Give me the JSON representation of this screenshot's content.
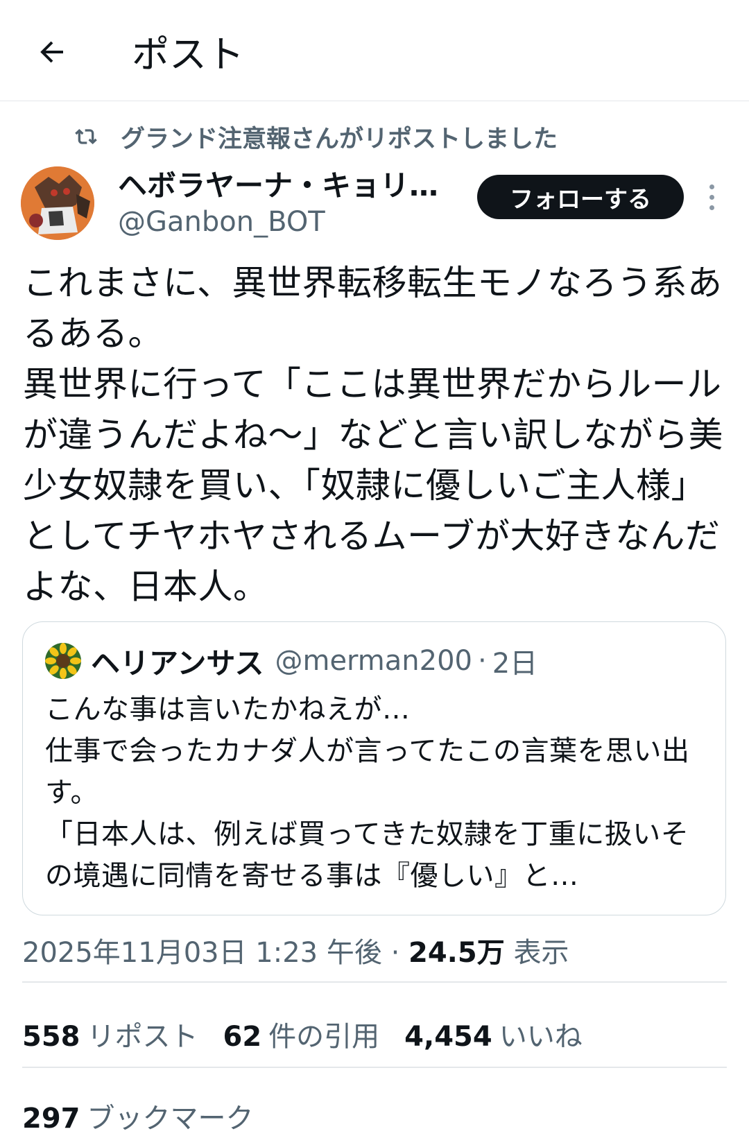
{
  "header": {
    "title": "ポスト"
  },
  "repost": {
    "text": "グランド注意報さんがリポストしました"
  },
  "author": {
    "name": "ヘボラヤーナ・キョリ…",
    "handle": "@Ganbon_BOT",
    "follow_label": "フォローする"
  },
  "post": {
    "body": "これまさに、異世界転移転生モノなろう系あるある。\n異世界に行って「ここは異世界だからルールが違うんだよね〜」などと言い訳しながら美少女奴隷を買い、「奴隷に優しいご主人様」としてチヤホヤされるムーブが大好きなんだよな、日本人。"
  },
  "quote": {
    "name": "ヘリアンサス",
    "handle": "@merman200",
    "separator": "·",
    "time": "2日",
    "body": "こんな事は言いたかねえが…\n仕事で会ったカナダ人が言ってたこの言葉を思い出す。\n「日本人は、例えば買ってきた奴隷を丁重に扱いその境遇に同情を寄せる事は『優しい』と…"
  },
  "meta": {
    "timestamp": "2025年11月03日 1:23 午後",
    "separator": "·",
    "views_count": "24.5万",
    "views_label": "表示"
  },
  "stats": {
    "reposts_count": "558",
    "reposts_label": "リポスト",
    "quotes_count": "62",
    "quotes_label": "件の引用",
    "likes_count": "4,454",
    "likes_label": "いいね",
    "bookmarks_count": "297",
    "bookmarks_label": "ブックマーク"
  },
  "icons": {
    "back": "arrow-left-icon",
    "repost": "repost-icon",
    "more": "more-vertical-icon"
  },
  "colors": {
    "text_primary": "#0f1419",
    "text_secondary": "#536471",
    "border": "#cfd9de",
    "follow_bg": "#0f1419"
  }
}
